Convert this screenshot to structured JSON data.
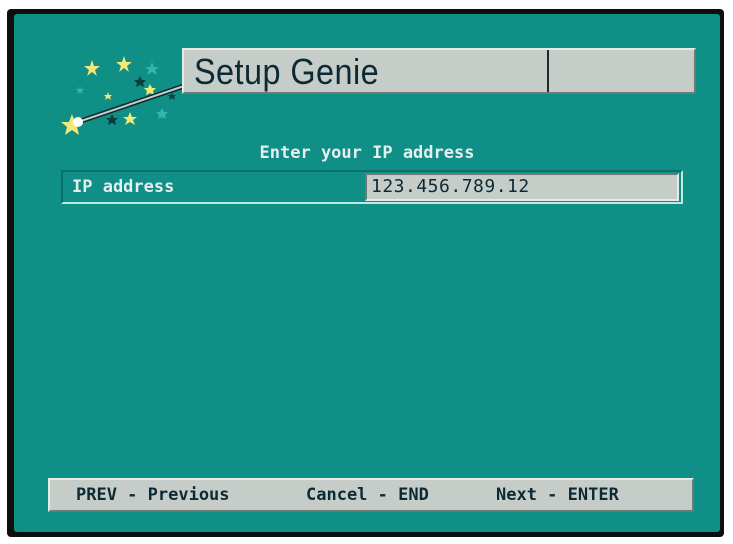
{
  "header": {
    "title": "Setup Genie",
    "logo_icon": "magic-wand-stars-icon"
  },
  "prompt": "Enter your IP address",
  "ip_entry": {
    "label": "IP address",
    "value": "123.456.789.12"
  },
  "footer": {
    "prev_hint": "PREV - Previous",
    "cancel_hint": "Cancel - END",
    "next_hint": "Next - ENTER"
  },
  "colors": {
    "background": "#0f8f86",
    "panel": "#c6cdc8",
    "panel_text": "#0c2a35",
    "screen_text": "#e6eef0",
    "stars": "#f2e87a"
  }
}
